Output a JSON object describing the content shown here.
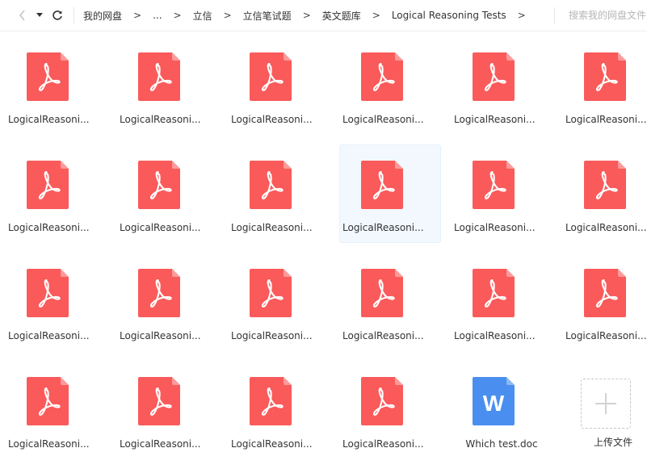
{
  "toolbar": {
    "back_icon": "chevron-left-icon",
    "history_icon": "caret-down-icon",
    "refresh_icon": "refresh-icon",
    "breadcrumb": [
      "我的网盘",
      "...",
      "立信",
      "立信笔试题",
      "英文题库",
      "Logical Reasoning Tests"
    ],
    "crumb_separator": ">",
    "search_placeholder": "搜索我的网盘文件"
  },
  "colors": {
    "pdf_red": "#fa5a5a",
    "pdf_fold": "#fd9a9a",
    "doc_blue": "#4a8ff0",
    "selected_bg": "#f2f8fe"
  },
  "files": [
    {
      "name": "LogicalReasoni...",
      "type": "pdf"
    },
    {
      "name": "LogicalReasoni...",
      "type": "pdf"
    },
    {
      "name": "LogicalReasoni...",
      "type": "pdf"
    },
    {
      "name": "LogicalReasoni...",
      "type": "pdf"
    },
    {
      "name": "LogicalReasoni...",
      "type": "pdf"
    },
    {
      "name": "LogicalReasoni...",
      "type": "pdf"
    },
    {
      "name": "LogicalReasoni...",
      "type": "pdf"
    },
    {
      "name": "LogicalReasoni...",
      "type": "pdf"
    },
    {
      "name": "LogicalReasoni...",
      "type": "pdf"
    },
    {
      "name": "LogicalReasoni...",
      "type": "pdf",
      "selected": true
    },
    {
      "name": "LogicalReasoni...",
      "type": "pdf"
    },
    {
      "name": "LogicalReasoni...",
      "type": "pdf"
    },
    {
      "name": "LogicalReasoni...",
      "type": "pdf"
    },
    {
      "name": "LogicalReasoni...",
      "type": "pdf"
    },
    {
      "name": "LogicalReasoni...",
      "type": "pdf"
    },
    {
      "name": "LogicalReasoni...",
      "type": "pdf"
    },
    {
      "name": "LogicalReasoni...",
      "type": "pdf"
    },
    {
      "name": "LogicalReasoni...",
      "type": "pdf"
    },
    {
      "name": "LogicalReasoni...",
      "type": "pdf"
    },
    {
      "name": "LogicalReasoni...",
      "type": "pdf"
    },
    {
      "name": "LogicalReasoni...",
      "type": "pdf"
    },
    {
      "name": "LogicalReasoni...",
      "type": "pdf"
    },
    {
      "name": "Which test.doc",
      "type": "doc",
      "icon_letter": "W"
    }
  ],
  "upload": {
    "label": "上传文件",
    "icon": "plus-icon"
  }
}
